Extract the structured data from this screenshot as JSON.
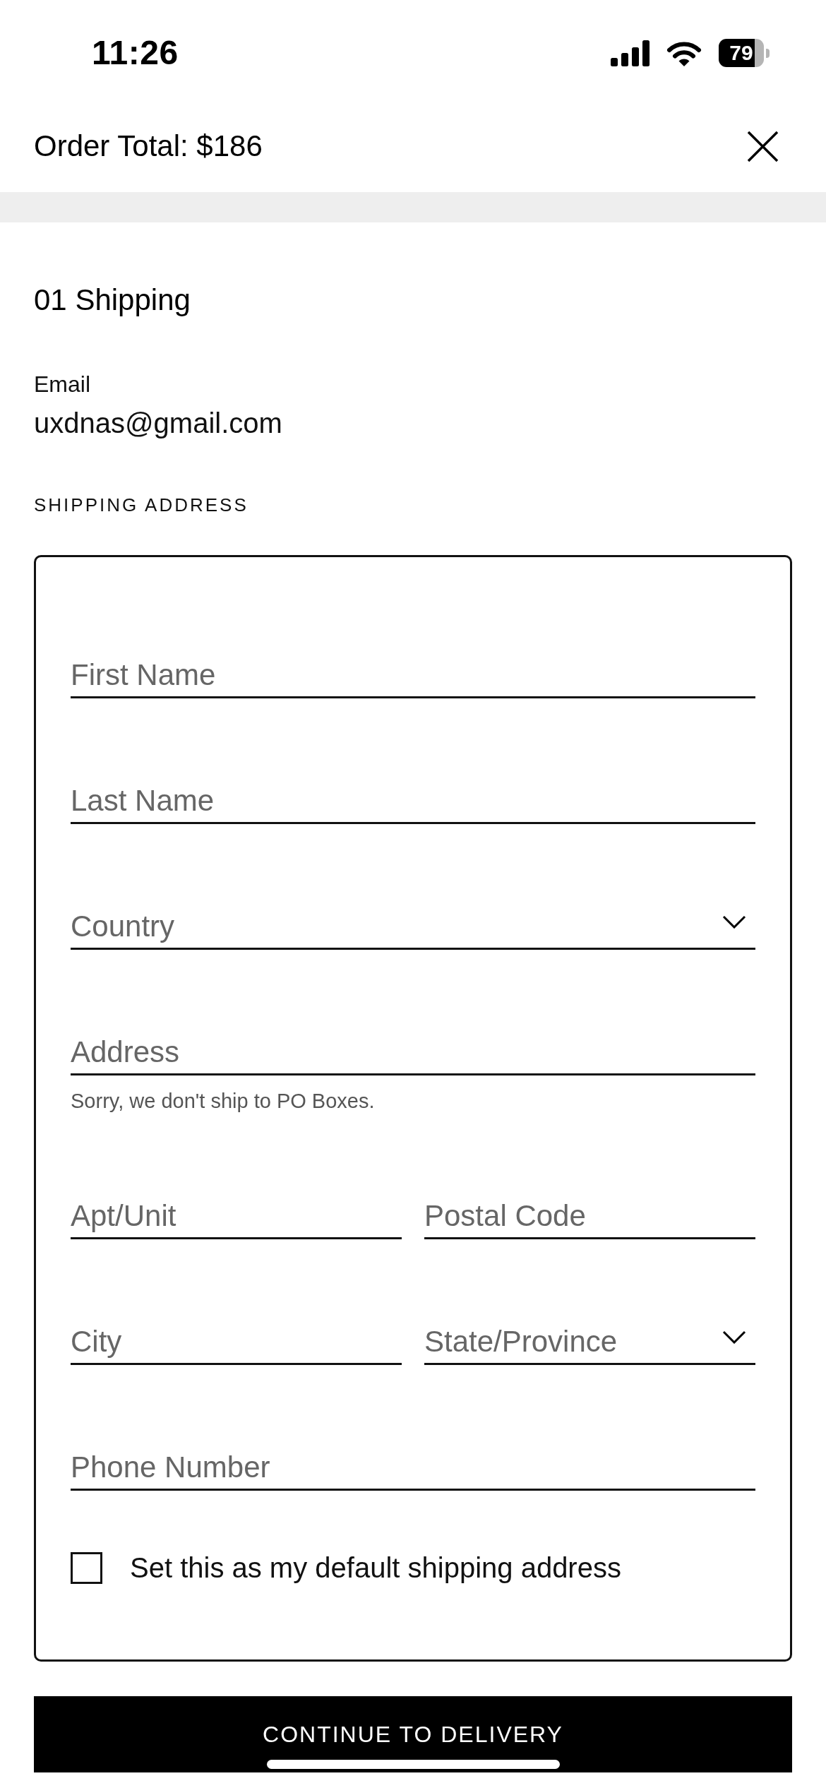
{
  "status_bar": {
    "time": "11:26",
    "battery": "79"
  },
  "header": {
    "title": "Order Total: $186"
  },
  "step": {
    "title": "01 Shipping"
  },
  "email": {
    "label": "Email",
    "value": "uxdnas@gmail.com"
  },
  "shipping_address": {
    "heading": "SHIPPING ADDRESS",
    "rows": [
      {
        "fields": [
          {
            "kind": "text",
            "placeholder": "First Name"
          }
        ]
      },
      {
        "fields": [
          {
            "kind": "text",
            "placeholder": "Last Name"
          }
        ]
      },
      {
        "fields": [
          {
            "kind": "select",
            "placeholder": "Country"
          }
        ]
      },
      {
        "fields": [
          {
            "kind": "text",
            "placeholder": "Address",
            "hint": "Sorry, we don't ship to PO Boxes."
          }
        ]
      },
      {
        "fields": [
          {
            "kind": "text",
            "placeholder": "Apt/Unit"
          },
          {
            "kind": "text",
            "placeholder": "Postal Code"
          }
        ]
      },
      {
        "fields": [
          {
            "kind": "text",
            "placeholder": "City"
          },
          {
            "kind": "select",
            "placeholder": "State/Province"
          }
        ]
      },
      {
        "fields": [
          {
            "kind": "text",
            "placeholder": "Phone Number"
          }
        ]
      }
    ],
    "default_checkbox": {
      "label": "Set this as my default shipping address",
      "checked": false
    }
  },
  "continue_button": {
    "label": "CONTINUE TO DELIVERY"
  }
}
